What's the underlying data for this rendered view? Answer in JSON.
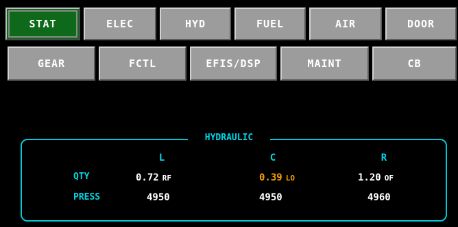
{
  "nav": {
    "row1": {
      "stat": "STAT",
      "elec": "ELEC",
      "hyd": "HYD",
      "fuel": "FUEL",
      "air": "AIR",
      "door": "DOOR"
    },
    "row2": {
      "gear": "GEAR",
      "fctl": "FCTL",
      "efis": "EFIS/DSP",
      "maint": "MAINT",
      "cb": "CB"
    },
    "active": "STAT"
  },
  "hydraulic": {
    "title": "HYDRAULIC",
    "columns": {
      "l": "L",
      "c": "C",
      "r": "R"
    },
    "labels": {
      "qty": "QTY",
      "press": "PRESS"
    },
    "qty": {
      "l": {
        "value": "0.72",
        "flag": "RF"
      },
      "c": {
        "value": "0.39",
        "flag": "LO"
      },
      "r": {
        "value": "1.20",
        "flag": "OF"
      }
    },
    "press": {
      "l": "4950",
      "c": "4950",
      "r": "4960"
    }
  },
  "colors": {
    "background": "#000000",
    "button": "#9c9c9c",
    "active_button": "#0e6a1a",
    "cyan": "#00d8e8",
    "amber": "#f5a000",
    "white": "#ffffff"
  }
}
